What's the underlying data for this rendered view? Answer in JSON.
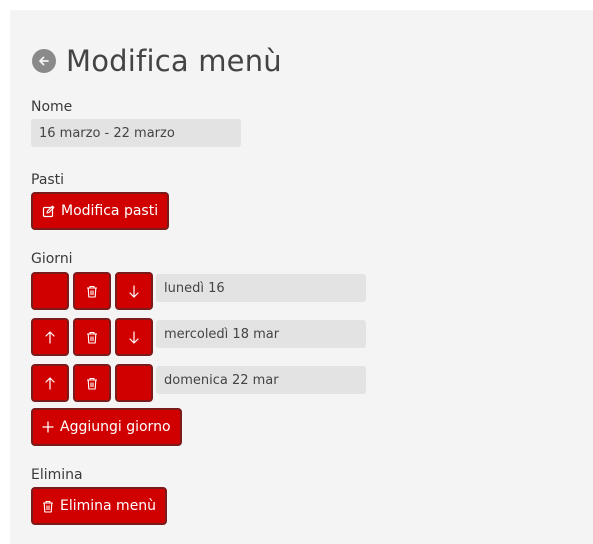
{
  "page": {
    "title": "Modifica menù",
    "back_icon": "arrow-left-circle-icon"
  },
  "name_section": {
    "label": "Nome",
    "value": "16 marzo - 22 marzo"
  },
  "meals_section": {
    "label": "Pasti",
    "button_label": "Modifica pasti",
    "button_icon": "edit-icon"
  },
  "days_section": {
    "label": "Giorni",
    "days": [
      {
        "value": "lunedì 16",
        "has_up": false,
        "has_down": true
      },
      {
        "value": "mercoledì 18 mar",
        "has_up": true,
        "has_down": true
      },
      {
        "value": "domenica 22 mar",
        "has_up": true,
        "has_down": false
      }
    ],
    "add_button_label": "Aggiungi giorno",
    "add_button_icon": "plus-icon"
  },
  "delete_section": {
    "label": "Elimina",
    "button_label": "Elimina menù",
    "button_icon": "trash-icon"
  },
  "colors": {
    "accent": "#d10000",
    "accent_border": "#7a1a1a",
    "panel": "#f4f4f4",
    "field": "#e3e3e3"
  }
}
